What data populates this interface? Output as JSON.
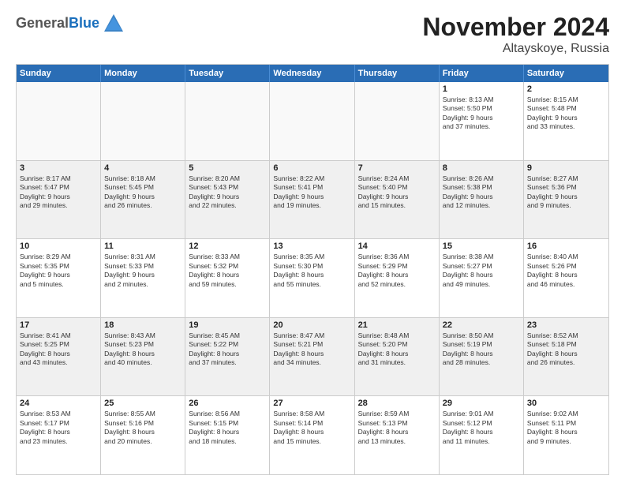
{
  "logo": {
    "general": "General",
    "blue": "Blue"
  },
  "header": {
    "month": "November 2024",
    "location": "Altayskoye, Russia"
  },
  "weekdays": [
    "Sunday",
    "Monday",
    "Tuesday",
    "Wednesday",
    "Thursday",
    "Friday",
    "Saturday"
  ],
  "rows": [
    [
      {
        "day": "",
        "info": "",
        "empty": true
      },
      {
        "day": "",
        "info": "",
        "empty": true
      },
      {
        "day": "",
        "info": "",
        "empty": true
      },
      {
        "day": "",
        "info": "",
        "empty": true
      },
      {
        "day": "",
        "info": "",
        "empty": true
      },
      {
        "day": "1",
        "info": "Sunrise: 8:13 AM\nSunset: 5:50 PM\nDaylight: 9 hours\nand 37 minutes."
      },
      {
        "day": "2",
        "info": "Sunrise: 8:15 AM\nSunset: 5:48 PM\nDaylight: 9 hours\nand 33 minutes."
      }
    ],
    [
      {
        "day": "3",
        "info": "Sunrise: 8:17 AM\nSunset: 5:47 PM\nDaylight: 9 hours\nand 29 minutes."
      },
      {
        "day": "4",
        "info": "Sunrise: 8:18 AM\nSunset: 5:45 PM\nDaylight: 9 hours\nand 26 minutes."
      },
      {
        "day": "5",
        "info": "Sunrise: 8:20 AM\nSunset: 5:43 PM\nDaylight: 9 hours\nand 22 minutes."
      },
      {
        "day": "6",
        "info": "Sunrise: 8:22 AM\nSunset: 5:41 PM\nDaylight: 9 hours\nand 19 minutes."
      },
      {
        "day": "7",
        "info": "Sunrise: 8:24 AM\nSunset: 5:40 PM\nDaylight: 9 hours\nand 15 minutes."
      },
      {
        "day": "8",
        "info": "Sunrise: 8:26 AM\nSunset: 5:38 PM\nDaylight: 9 hours\nand 12 minutes."
      },
      {
        "day": "9",
        "info": "Sunrise: 8:27 AM\nSunset: 5:36 PM\nDaylight: 9 hours\nand 9 minutes."
      }
    ],
    [
      {
        "day": "10",
        "info": "Sunrise: 8:29 AM\nSunset: 5:35 PM\nDaylight: 9 hours\nand 5 minutes."
      },
      {
        "day": "11",
        "info": "Sunrise: 8:31 AM\nSunset: 5:33 PM\nDaylight: 9 hours\nand 2 minutes."
      },
      {
        "day": "12",
        "info": "Sunrise: 8:33 AM\nSunset: 5:32 PM\nDaylight: 8 hours\nand 59 minutes."
      },
      {
        "day": "13",
        "info": "Sunrise: 8:35 AM\nSunset: 5:30 PM\nDaylight: 8 hours\nand 55 minutes."
      },
      {
        "day": "14",
        "info": "Sunrise: 8:36 AM\nSunset: 5:29 PM\nDaylight: 8 hours\nand 52 minutes."
      },
      {
        "day": "15",
        "info": "Sunrise: 8:38 AM\nSunset: 5:27 PM\nDaylight: 8 hours\nand 49 minutes."
      },
      {
        "day": "16",
        "info": "Sunrise: 8:40 AM\nSunset: 5:26 PM\nDaylight: 8 hours\nand 46 minutes."
      }
    ],
    [
      {
        "day": "17",
        "info": "Sunrise: 8:41 AM\nSunset: 5:25 PM\nDaylight: 8 hours\nand 43 minutes."
      },
      {
        "day": "18",
        "info": "Sunrise: 8:43 AM\nSunset: 5:23 PM\nDaylight: 8 hours\nand 40 minutes."
      },
      {
        "day": "19",
        "info": "Sunrise: 8:45 AM\nSunset: 5:22 PM\nDaylight: 8 hours\nand 37 minutes."
      },
      {
        "day": "20",
        "info": "Sunrise: 8:47 AM\nSunset: 5:21 PM\nDaylight: 8 hours\nand 34 minutes."
      },
      {
        "day": "21",
        "info": "Sunrise: 8:48 AM\nSunset: 5:20 PM\nDaylight: 8 hours\nand 31 minutes."
      },
      {
        "day": "22",
        "info": "Sunrise: 8:50 AM\nSunset: 5:19 PM\nDaylight: 8 hours\nand 28 minutes."
      },
      {
        "day": "23",
        "info": "Sunrise: 8:52 AM\nSunset: 5:18 PM\nDaylight: 8 hours\nand 26 minutes."
      }
    ],
    [
      {
        "day": "24",
        "info": "Sunrise: 8:53 AM\nSunset: 5:17 PM\nDaylight: 8 hours\nand 23 minutes."
      },
      {
        "day": "25",
        "info": "Sunrise: 8:55 AM\nSunset: 5:16 PM\nDaylight: 8 hours\nand 20 minutes."
      },
      {
        "day": "26",
        "info": "Sunrise: 8:56 AM\nSunset: 5:15 PM\nDaylight: 8 hours\nand 18 minutes."
      },
      {
        "day": "27",
        "info": "Sunrise: 8:58 AM\nSunset: 5:14 PM\nDaylight: 8 hours\nand 15 minutes."
      },
      {
        "day": "28",
        "info": "Sunrise: 8:59 AM\nSunset: 5:13 PM\nDaylight: 8 hours\nand 13 minutes."
      },
      {
        "day": "29",
        "info": "Sunrise: 9:01 AM\nSunset: 5:12 PM\nDaylight: 8 hours\nand 11 minutes."
      },
      {
        "day": "30",
        "info": "Sunrise: 9:02 AM\nSunset: 5:11 PM\nDaylight: 8 hours\nand 9 minutes."
      }
    ]
  ]
}
